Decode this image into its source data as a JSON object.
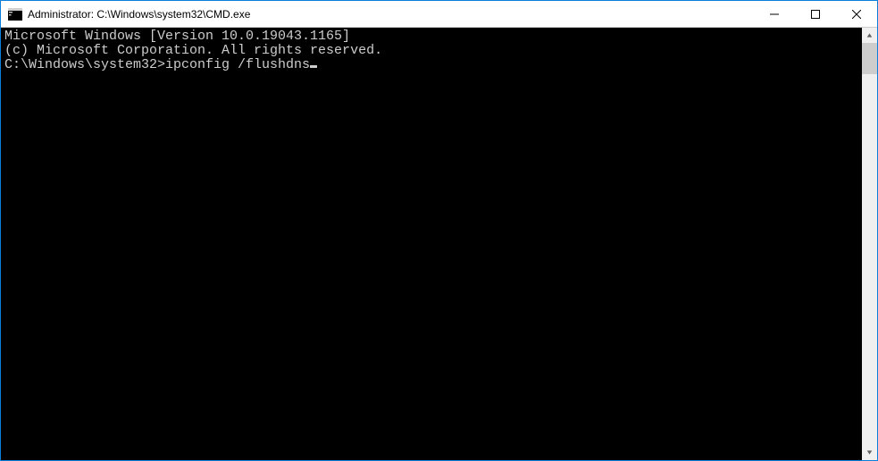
{
  "window": {
    "title": "Administrator: C:\\Windows\\system32\\CMD.exe"
  },
  "terminal": {
    "line1": "Microsoft Windows [Version 10.0.19043.1165]",
    "line2": "(c) Microsoft Corporation. All rights reserved.",
    "blank": "",
    "prompt": "C:\\Windows\\system32>",
    "command": "ipconfig /flushdns"
  }
}
